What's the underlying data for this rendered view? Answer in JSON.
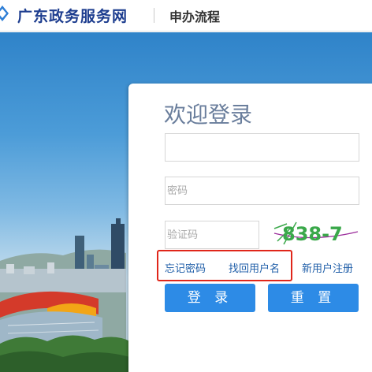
{
  "header": {
    "logo_icon": "diamond-logo-icon",
    "site_name": "广东政务服务网",
    "section_title": "申办流程"
  },
  "colors": {
    "brand": "#1d3d8f",
    "button": "#2d8be6",
    "link": "#1f5ea8",
    "highlight": "#e0261a",
    "welcome_text": "#6a7e9c"
  },
  "login": {
    "welcome": "欢迎登录",
    "username_value": "",
    "password_placeholder": "密码",
    "captcha_placeholder": "验证码",
    "captcha_text": "838-7",
    "forgot_password": "忘记密码",
    "recover_username": "找回用户名",
    "register": "新用户注册",
    "login_button": "登 录",
    "reset_button": "重 置"
  }
}
